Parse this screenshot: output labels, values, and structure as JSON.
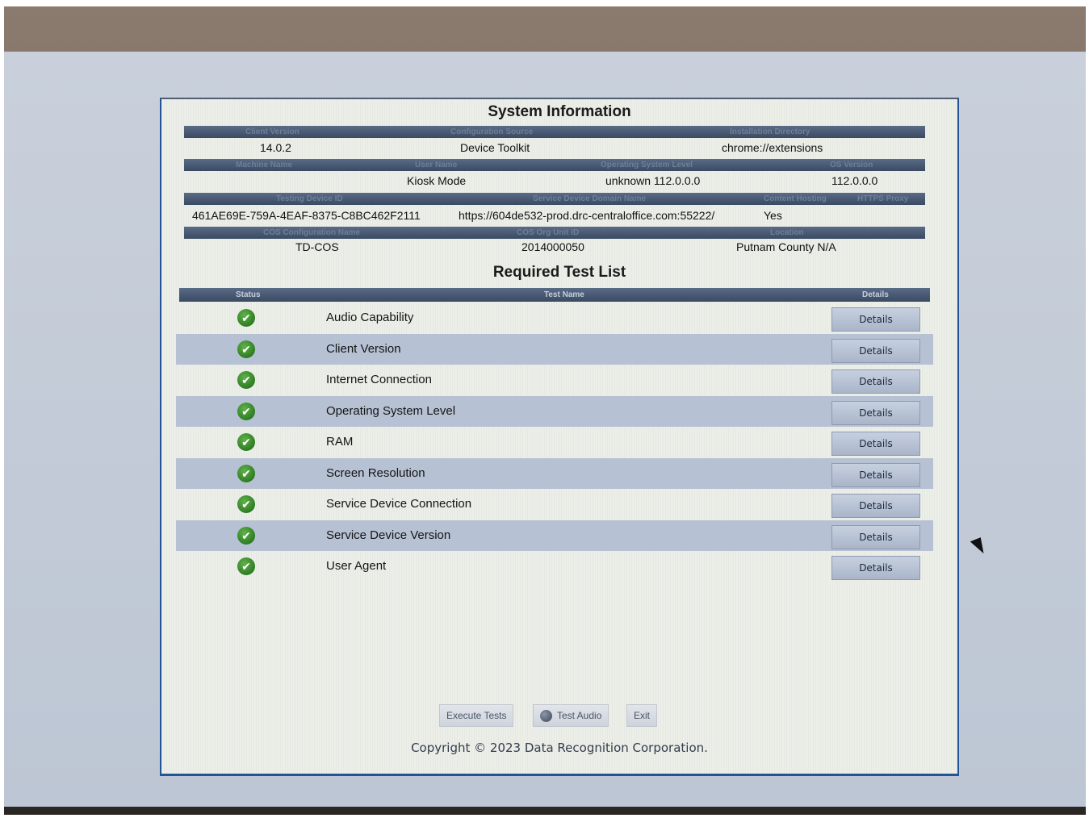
{
  "system_info": {
    "title": "System Information",
    "row1_headers": [
      "Client Version",
      "Configuration Source",
      "Installation Directory"
    ],
    "row1_values": [
      "14.0.2",
      "Device Toolkit",
      "chrome://extensions"
    ],
    "row2_headers": [
      "Machine Name",
      "User Name",
      "Operating System Level",
      "OS Version"
    ],
    "row2_values": [
      "",
      "Kiosk Mode",
      "unknown 112.0.0.0",
      "112.0.0.0"
    ],
    "row3_headers": [
      "Testing Device ID",
      "Service Device Domain Name",
      "Content Hosting",
      "HTTPS Proxy"
    ],
    "row3_values": [
      "461AE69E-759A-4EAF-8375-C8BC462F2111",
      "https://604de532-prod.drc-centraloffice.com:55222/",
      "Yes",
      ""
    ],
    "row4_headers": [
      "COS Configuration Name",
      "COS Org Unit ID",
      "Location"
    ],
    "row4_values": [
      "TD-COS",
      "2014000050",
      "Putnam County N/A"
    ]
  },
  "tests": {
    "title": "Required Test List",
    "headers": {
      "status": "Status",
      "name": "Test Name",
      "details": "Details"
    },
    "details_label": "Details",
    "status_icon": "check-circle-icon",
    "items": [
      "Audio Capability",
      "Client Version",
      "Internet Connection",
      "Operating System Level",
      "RAM",
      "Screen Resolution",
      "Service Device Connection",
      "Service Device Version",
      "User Agent"
    ]
  },
  "actions": {
    "execute": "Execute Tests",
    "audio": "Test Audio",
    "exit": "Exit"
  },
  "footer": {
    "copyright": "Copyright © 2023 Data Recognition Corporation."
  },
  "colors": {
    "header_bar": "#3a4a63",
    "alt_row": "#b6c1d3",
    "check": "#2f7d23",
    "border": "#23549a"
  }
}
